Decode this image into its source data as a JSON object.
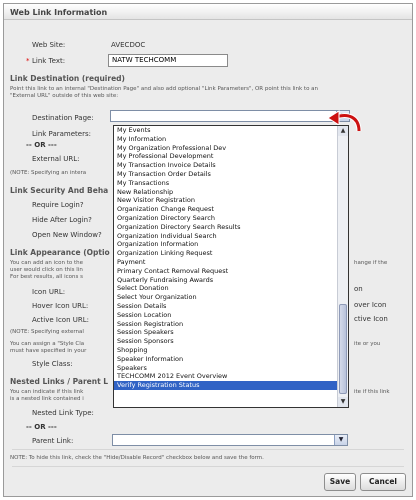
{
  "header": {
    "title": "Web Link Information"
  },
  "fields": {
    "web_site_label": "Web Site:",
    "web_site_value": "AVECDOC",
    "link_text_required": "*",
    "link_text_label": "Link Text:",
    "link_text_value": "NATW TECHCOMM"
  },
  "link_destination": {
    "title": "Link Destination (required)",
    "note_line1": "Point this link to an internal \"Destination Page\" and also add optional \"Link Parameters\", OR point this link to an",
    "note_line2": "\"External URL\" outside of this web site:",
    "destination_page_label": "Destination Page:",
    "link_parameters_label": "Link Parameters:",
    "or_label": "-- OR ---",
    "external_url_label": "External URL:",
    "note_visible": "(NOTE: Specifying an intera"
  },
  "security": {
    "title": "Link Security And Beha",
    "require_login_label": "Require Login?",
    "hide_after_login_label": "Hide After Login?",
    "open_new_window_label": "Open New Window?"
  },
  "appearance": {
    "title": "Link Appearance (Optio",
    "note_line1": "You can add an icon to the",
    "note_line1_right": "hange if the",
    "note_line2": "user would click on this lin",
    "note_line3": "For best results, all icons s",
    "icon_url_label": "Icon URL:",
    "icon_url_right": "on",
    "hover_icon_url_label": "Hover Icon URL:",
    "hover_icon_right": "over Icon",
    "active_icon_url_label": "Active Icon URL:",
    "active_icon_right": "ctive Icon",
    "external_note": "(NOTE: Specifying external",
    "style_note_line1": "You can assign a \"Style Cla",
    "style_note_line1_right": "ite or you",
    "style_note_line2": "must have specified in your",
    "style_class_label": "Style Class:"
  },
  "nested": {
    "title": "Nested Links / Parent L",
    "note_line1": "You can indicate if this link",
    "note_line1_right": "ite if this link",
    "note_line2": "is a nested link contained i",
    "nested_link_type_label": "Nested Link Type:",
    "or_label": "-- OR ---",
    "parent_link_label": "Parent Link:"
  },
  "footer": {
    "note": "NOTE: To hide this link, check the \"Hide/Disable Record\" checkbox below and save the form.",
    "save_label": "Save",
    "cancel_label": "Cancel"
  },
  "dropdown": {
    "selected_index": 29,
    "items": [
      "My Events",
      "My Information",
      "My Organization Professional Dev",
      "My Professional Development",
      "My Transaction Invoice Details",
      "My Transaction Order Details",
      "My Transactions",
      "New Relationship",
      "New Visitor Registration",
      "Organization Change Request",
      "Organization Directory Search",
      "Organization Directory Search Results",
      "Organization Individual Search",
      "Organization Information",
      "Organization Linking Request",
      "Payment",
      "Primary Contact Removal Request",
      "Quarterly Fundraising Awards",
      "Select Donation",
      "Select Your Organization",
      "Session Details",
      "Session Location",
      "Session Registration",
      "Session Speakers",
      "Session Sponsors",
      "Shopping",
      "Speaker Information",
      "Speakers",
      "TECHCOMM 2012 Event Overview",
      "Verify Registration Status"
    ]
  },
  "icons": {
    "arrow": "curved-arrow-icon",
    "dropdown": "chevron-down-icon",
    "scroll_up": "scroll-up-icon",
    "scroll_down": "scroll-down-icon"
  },
  "colors": {
    "selection": "#3163c5",
    "required": "#dd0000",
    "arrow": "#cc1111"
  }
}
